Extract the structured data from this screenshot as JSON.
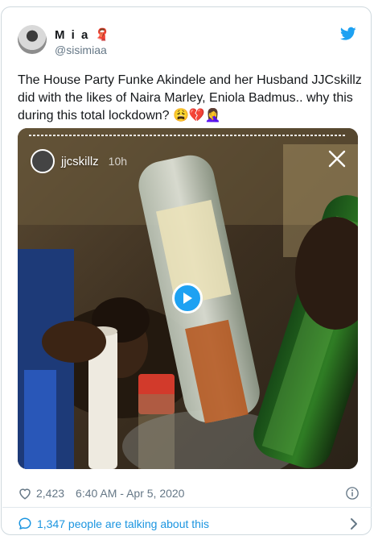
{
  "author": {
    "display_name": "M i a",
    "name_emoji": "🧣",
    "handle": "@sisimiaa"
  },
  "tweet": {
    "text": "The House Party Funke Akindele and her Husband JJCskillz did with the likes of Naira Marley, Eniola Badmus.. why this during this total lockdown? 😩💔🤦‍♀️"
  },
  "media": {
    "story_username": "jjcskillz",
    "story_time": "10h",
    "play_icon": "play-icon",
    "close_icon": "close-icon"
  },
  "meta": {
    "likes": "2,423",
    "timestamp": "6:40 AM - Apr 5, 2020"
  },
  "footer": {
    "conversation_text": "1,347 people are talking about this"
  },
  "colors": {
    "accent": "#1da1f2",
    "link": "#1b95e0",
    "muted": "#657786",
    "border": "#cfd9de"
  }
}
